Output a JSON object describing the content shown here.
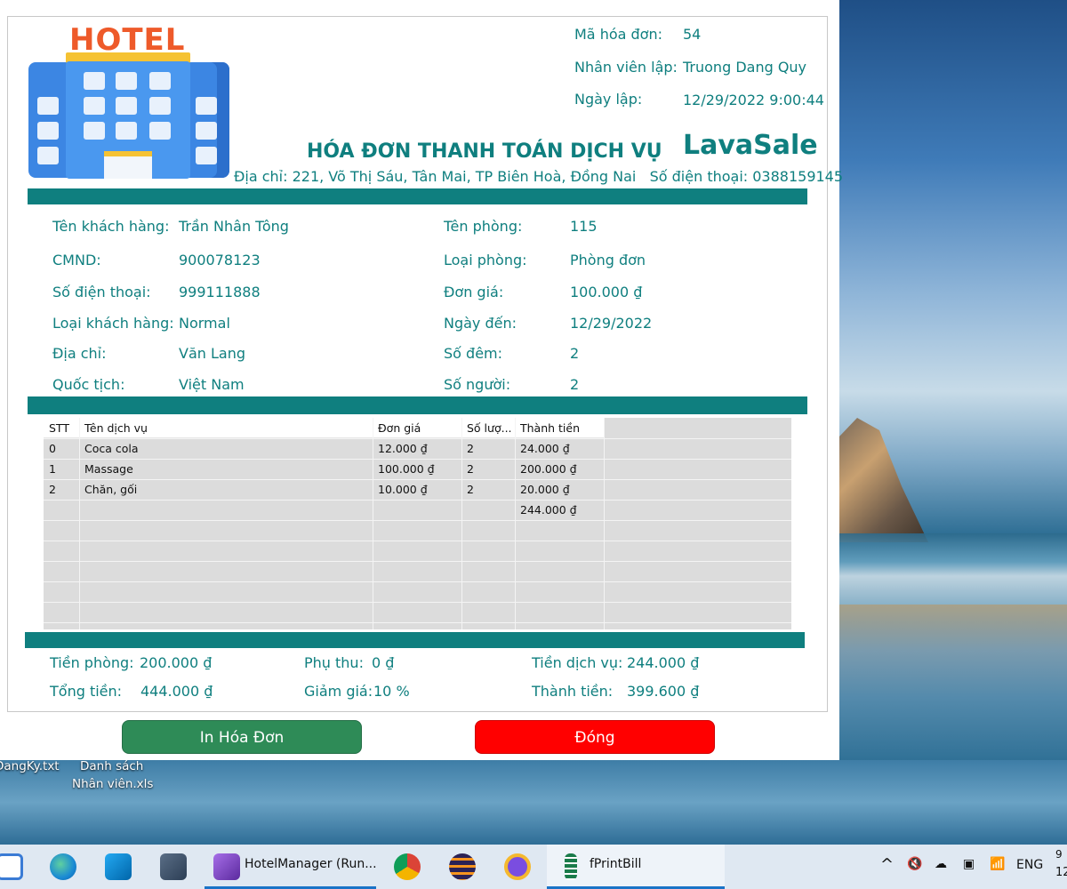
{
  "logo": {
    "text": "HOTEL"
  },
  "invoice": {
    "id_label": "Mã hóa đơn:",
    "id": "54",
    "staff_label": "Nhân viên lập:",
    "staff": "Truong Dang Quy",
    "date_label": "Ngày lập:",
    "date": "12/29/2022 9:00:44",
    "title": "HÓA ĐƠN THANH TOÁN DỊCH VỤ",
    "brand": "LavaSale",
    "address": "Địa chỉ: 221, Võ Thị Sáu, Tân Mai, TP Biên Hoà, Đồng Nai   Số điện thoại: 0388159145"
  },
  "customer": {
    "name_label": "Tên khách hàng:",
    "name": "Trần Nhân Tông",
    "id_label": "CMND:",
    "id": "900078123",
    "phone_label": "Số điện thoại:",
    "phone": "999111888",
    "type_label": "Loại khách hàng:",
    "type": "Normal",
    "address_label": "Địa chỉ:",
    "address": "Văn Lang",
    "nationality_label": "Quốc tịch:",
    "nationality": "Việt Nam"
  },
  "room": {
    "name_label": "Tên phòng:",
    "name": "115",
    "type_label": "Loại phòng:",
    "type": "Phòng đơn",
    "price_label": "Đơn giá:",
    "price": "100.000 ₫",
    "arrival_label": "Ngày đến:",
    "arrival": "12/29/2022",
    "nights_label": "Số đêm:",
    "nights": "2",
    "guests_label": "Số người:",
    "guests": "2"
  },
  "services": {
    "columns": [
      "STT",
      "Tên dịch vụ",
      "Đơn giá",
      "Số lượ...",
      "Thành tiền"
    ],
    "rows": [
      [
        "0",
        "Coca cola",
        "12.000 ₫",
        "2",
        "24.000 ₫"
      ],
      [
        "1",
        "Massage",
        "100.000 ₫",
        "2",
        "200.000 ₫"
      ],
      [
        "2",
        "Chăn, gối",
        "10.000 ₫",
        "2",
        "20.000 ₫"
      ],
      [
        "",
        "",
        "",
        "",
        "244.000 ₫"
      ]
    ]
  },
  "totals": {
    "room_label": "Tiền phòng:",
    "room": "200.000 ₫",
    "surcharge_label": "Phụ thu:",
    "surcharge": "0 ₫",
    "service_label": "Tiền dịch vụ:",
    "service": "244.000 ₫",
    "total_label": "Tổng tiền:",
    "total": "444.000 ₫",
    "discount_label": "Giảm giá:",
    "discount": "10 %",
    "final_label": "Thành tiền:",
    "final": "399.600 ₫"
  },
  "buttons": {
    "print": "In Hóa Đơn",
    "close": "Đóng"
  },
  "desktop": {
    "file1": "DangKy.txt",
    "file2_line1": "Danh sách",
    "file2_line2": "Nhân viên.xls"
  },
  "taskbar": {
    "app1": "HotelManager (Run...",
    "app2": "fPrintBill",
    "lang": "ENG",
    "clock_time": "9",
    "clock_date": "12"
  },
  "colors": {
    "accent": "#0f7f7f",
    "print_button": "#2e8b57",
    "close_button": "#ff0000"
  }
}
